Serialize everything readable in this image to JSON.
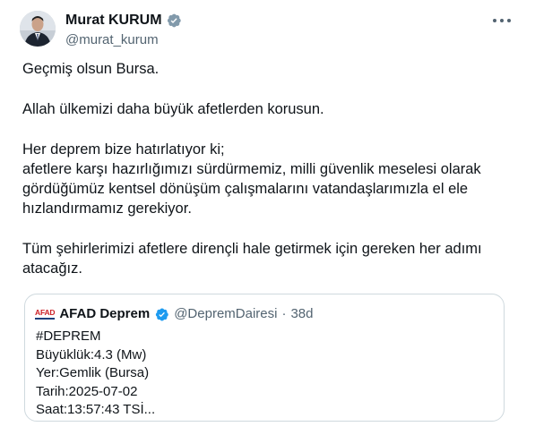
{
  "author": {
    "name": "Murat KURUM",
    "handle": "@murat_kurum",
    "verified_icon": "verified-badge-icon",
    "verified_color": "#829aab"
  },
  "menu": {
    "more_icon": "more-horizontal-icon"
  },
  "post": {
    "paragraphs": [
      "Geçmiş olsun Bursa.",
      "Allah ülkemizi daha büyük afetlerden korusun.",
      "Her deprem bize hatırlatıyor ki;\nafetlere karşı hazırlığımızı sürdürmemiz, milli güvenlik meselesi olarak gördüğümüz kentsel dönüşüm çalışmalarını vatandaşlarımızla el ele hızlandırmamız gerekiyor.",
      "Tüm şehirlerimizi afetlere dirençli hale getirmek için gereken her adımı atacağız."
    ]
  },
  "quoted": {
    "logo_text": "AFAD",
    "name": "AFAD Deprem",
    "handle": "@DepremDairesi",
    "separator": "·",
    "time": "38d",
    "verified_color": "#1d9bf0",
    "lines": [
      "#DEPREM",
      "Büyüklük:4.3 (Mw)",
      "Yer:Gemlik (Bursa)",
      "Tarih:2025-07-02",
      "Saat:13:57:43 TSİ..."
    ]
  }
}
